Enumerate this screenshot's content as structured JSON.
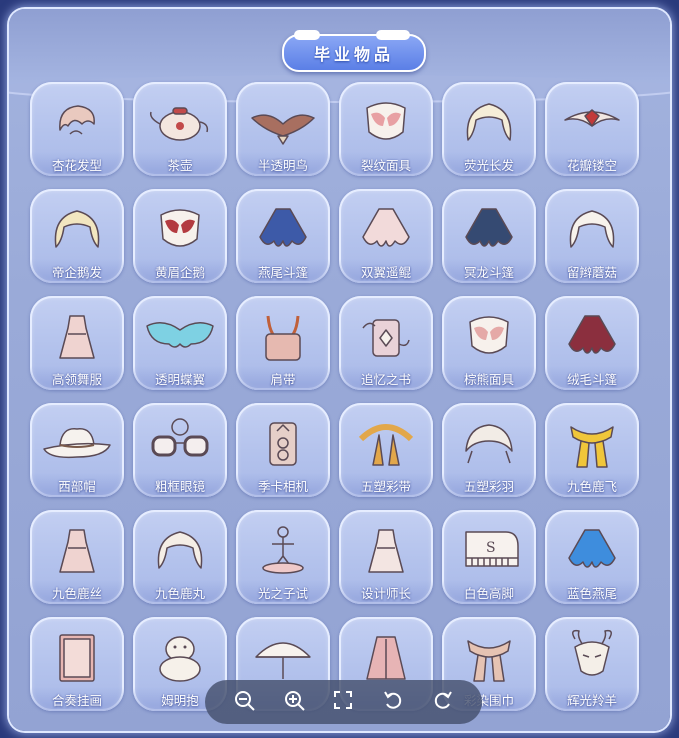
{
  "title": "毕业物品",
  "items": [
    {
      "label": "杏花发型",
      "icon": "hairstyle-icon",
      "color": "#e9c9bf"
    },
    {
      "label": "茶壶",
      "icon": "teapot-icon",
      "color": "#f3e6df"
    },
    {
      "label": "半透明鸟",
      "icon": "bird-icon",
      "color": "#a86f60"
    },
    {
      "label": "裂纹面具",
      "icon": "mask-icon",
      "color": "#e8a0a3"
    },
    {
      "label": "荧光长发",
      "icon": "hair-icon",
      "color": "#f5edd8"
    },
    {
      "label": "花瓣镂空",
      "icon": "petal-headwear-icon",
      "color": "#f2e7e2"
    },
    {
      "label": "帝企鹅发",
      "icon": "hair-icon",
      "color": "#f2e6c0"
    },
    {
      "label": "黄眉企鹅",
      "icon": "mask-icon",
      "color": "#b33a40"
    },
    {
      "label": "燕尾斗篷",
      "icon": "cape-icon",
      "color": "#3d5aa8"
    },
    {
      "label": "双翼遥鲲",
      "icon": "cape-icon",
      "color": "#f2dada"
    },
    {
      "label": "冥龙斗篷",
      "icon": "cape-icon",
      "color": "#354a72"
    },
    {
      "label": "留辫蘑菇",
      "icon": "hair-icon",
      "color": "#f7f2ec"
    },
    {
      "label": "高领舞服",
      "icon": "outfit-icon",
      "color": "#efd3d0"
    },
    {
      "label": "透明蝶翼",
      "icon": "wing-icon",
      "color": "#7ed1e3"
    },
    {
      "label": "肩带",
      "icon": "strap-icon",
      "color": "#e6b9b0"
    },
    {
      "label": "追忆之书",
      "icon": "book-icon",
      "color": "#e9d2d8"
    },
    {
      "label": "棕熊面具",
      "icon": "mask-icon",
      "color": "#e5a9a7"
    },
    {
      "label": "绒毛斗篷",
      "icon": "cape-icon",
      "color": "#8b2f3e"
    },
    {
      "label": "西部帽",
      "icon": "hat-icon",
      "color": "#f6f2ee"
    },
    {
      "label": "粗框眼镜",
      "icon": "glasses-icon",
      "color": "#f4eeee"
    },
    {
      "label": "季卡相机",
      "icon": "camera-icon",
      "color": "#e6cfc8"
    },
    {
      "label": "五塑彩带",
      "icon": "ribbon-icon",
      "color": "#e2a74a"
    },
    {
      "label": "五塑彩羽",
      "icon": "feather-icon",
      "color": "#f2ece6"
    },
    {
      "label": "九色鹿飞",
      "icon": "scarf-icon",
      "color": "#f0c63a"
    },
    {
      "label": "九色鹿丝",
      "icon": "outfit-icon",
      "color": "#efd3d0"
    },
    {
      "label": "九色鹿丸",
      "icon": "hair-icon",
      "color": "#f5eee6"
    },
    {
      "label": "光之子试",
      "icon": "figure-icon",
      "color": "#efc9c9"
    },
    {
      "label": "设计师长",
      "icon": "outfit-icon",
      "color": "#f3e5e2"
    },
    {
      "label": "白色高脚",
      "icon": "piano-icon",
      "color": "#f7f2ee"
    },
    {
      "label": "蓝色燕尾",
      "icon": "cape-icon",
      "color": "#3e8ddd"
    },
    {
      "label": "合奏挂画",
      "icon": "painting-icon",
      "color": "#e7b6b2"
    },
    {
      "label": "姆明抱",
      "icon": "plush-icon",
      "color": "#f6f1ea"
    },
    {
      "label": "",
      "icon": "umbrella-icon",
      "color": "#f7f2ee"
    },
    {
      "label": "",
      "icon": "coat-icon",
      "color": "#e7b4b5"
    },
    {
      "label": "彩染围巾",
      "icon": "scarf-icon",
      "color": "#e6c3b3"
    },
    {
      "label": "辉光羚羊",
      "icon": "antelope-mask-icon",
      "color": "#f4efe8"
    }
  ],
  "viewer": {
    "buttons": [
      {
        "name": "zoom-out-button",
        "icon": "zoom-out-icon"
      },
      {
        "name": "zoom-in-button",
        "icon": "zoom-in-icon"
      },
      {
        "name": "fullscreen-button",
        "icon": "fullscreen-icon"
      },
      {
        "name": "rotate-left-button",
        "icon": "rotate-left-icon"
      },
      {
        "name": "rotate-right-button",
        "icon": "rotate-right-icon"
      }
    ]
  }
}
